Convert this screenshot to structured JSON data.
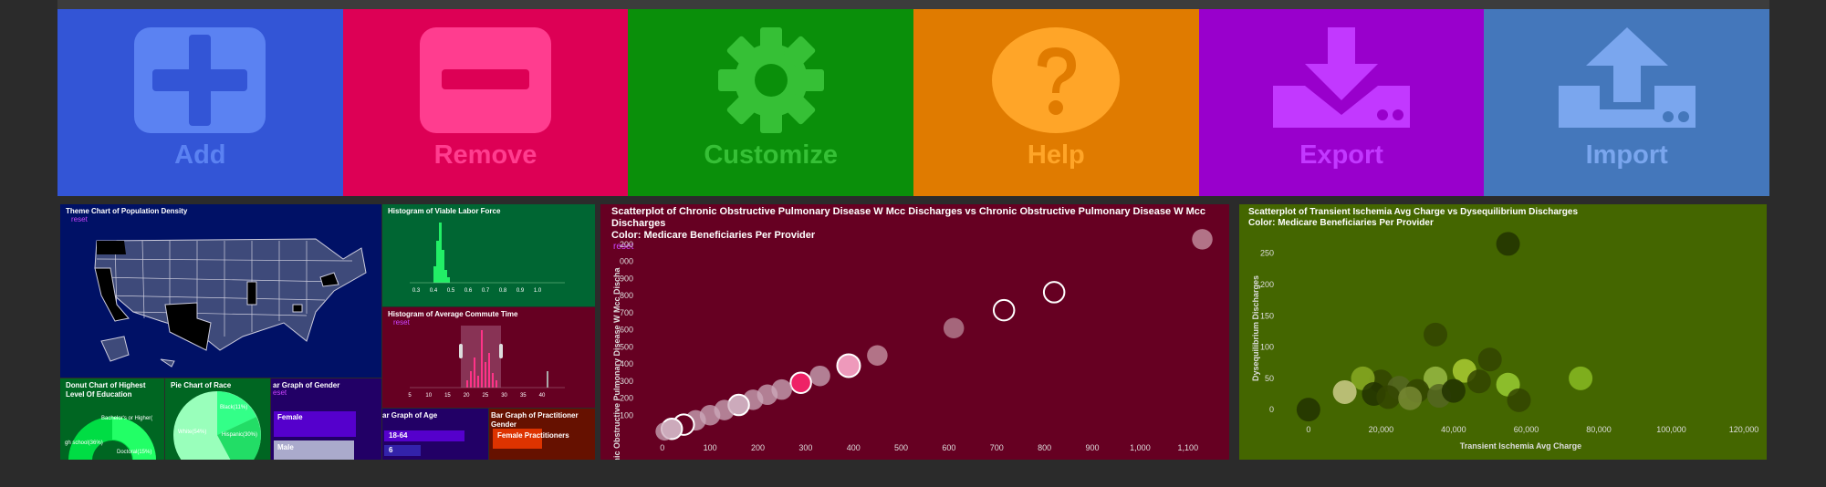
{
  "toolbar": {
    "tiles": [
      {
        "label": "Add",
        "icon": "plus-icon",
        "bg": "#3355d6",
        "fg": "#5b82f2"
      },
      {
        "label": "Remove",
        "icon": "minus-icon",
        "bg": "#dd0055",
        "fg": "#ff3d8f"
      },
      {
        "label": "Customize",
        "icon": "gear-icon",
        "bg": "#0a8f0a",
        "fg": "#36c036"
      },
      {
        "label": "Help",
        "icon": "question-icon",
        "bg": "#e07b00",
        "fg": "#ffa528"
      },
      {
        "label": "Export",
        "icon": "download-icon",
        "bg": "#9900cc",
        "fg": "#c238ff"
      },
      {
        "label": "Import",
        "icon": "upload-icon",
        "bg": "#4477bb",
        "fg": "#7aa6ee"
      }
    ]
  },
  "dashboard": {
    "map": {
      "title": "Theme Chart of Population Density",
      "reset": "reset",
      "bg": "#001166"
    },
    "hist_labor": {
      "title": "Histogram of Viable Labor Force",
      "bg": "#006633",
      "ticks": [
        "0.3",
        "0.4",
        "0.5",
        "0.6",
        "0.7",
        "0.8",
        "0.9",
        "1.0"
      ]
    },
    "hist_commute": {
      "title": "Histogram of Average Commute Time",
      "reset": "reset",
      "bg": "#660022",
      "ticks": [
        "5",
        "10",
        "15",
        "20",
        "25",
        "30",
        "35",
        "40"
      ]
    },
    "donut": {
      "title": "Donut Chart of Highest Level Of Education",
      "labels": [
        "Bachelor's or Higher(",
        "gh school(36%)",
        "Doctoral(15%)"
      ],
      "bg": "#006622"
    },
    "pie": {
      "title": "Pie Chart of Race",
      "labels": [
        "Black(11%)",
        "Hispanic(30%)",
        "White(54%)"
      ],
      "bg": "#006622"
    },
    "gender_bar": {
      "title": "ar Graph of Gender",
      "reset": "eset",
      "labels": [
        "Female",
        "Male"
      ],
      "bg": "#220066"
    },
    "age_bar": {
      "title": "ar Graph of Age",
      "labels": [
        "18-64",
        "6"
      ],
      "bg": "#220066"
    },
    "practitioner_bar": {
      "title": "Bar Graph of Practitioner Gender",
      "labels": [
        "Female Practitioners"
      ],
      "bg": "#661100"
    }
  },
  "scatter1": {
    "title": "Scatterplot of Chronic Obstructive Pulmonary Disease W Mcc Discharges vs Chronic Obstructive Pulmonary Disease W Mcc Discharges",
    "subtitle": "Color: Medicare Beneficiaries Per Provider",
    "reset": "reset",
    "bg": "#660022"
  },
  "scatter2": {
    "title": "Scatterplot of Transient Ischemia Avg Charge vs Dysequilibrium Discharges",
    "subtitle": "Color: Medicare Beneficiaries Per Provider",
    "bg": "#446600"
  },
  "chart_data": [
    {
      "type": "scatter",
      "ylabel": "Chronic Obstructive Pulmonary Disease W Mcc Discha",
      "xlim": [
        -30,
        1150
      ],
      "ylim": [
        0,
        1100
      ],
      "xticks": [
        0,
        100,
        200,
        300,
        400,
        500,
        600,
        700,
        800,
        900,
        1000,
        1100
      ],
      "xtick_labels": [
        "0",
        "100",
        "200",
        "300",
        "400",
        "500",
        "600",
        "700",
        "800",
        "900",
        "1,000",
        "1,100"
      ],
      "yticks": [
        100,
        200,
        300,
        400,
        500,
        600,
        700,
        800,
        900,
        1000,
        1100
      ],
      "ytick_labels": [
        "100",
        "200",
        "300",
        "400",
        "500",
        "600",
        "700",
        "800",
        "900",
        "000",
        "200"
      ],
      "points": [
        {
          "x": 1130,
          "y": 1130,
          "c": "#cc99aa",
          "r": 9,
          "ring": false
        },
        {
          "x": 820,
          "y": 820,
          "c": "#660022",
          "r": 9,
          "ring": true
        },
        {
          "x": 715,
          "y": 715,
          "c": "#660022",
          "r": 9,
          "ring": true
        },
        {
          "x": 610,
          "y": 610,
          "c": "#bb8899",
          "r": 9,
          "ring": false
        },
        {
          "x": 450,
          "y": 450,
          "c": "#cc99aa",
          "r": 9,
          "ring": false
        },
        {
          "x": 390,
          "y": 390,
          "c": "#ee99bb",
          "r": 10,
          "ring": true
        },
        {
          "x": 330,
          "y": 330,
          "c": "#ccaabb",
          "r": 9,
          "ring": false
        },
        {
          "x": 290,
          "y": 290,
          "c": "#ee2266",
          "r": 9,
          "ring": true
        },
        {
          "x": 250,
          "y": 250,
          "c": "#ccaabb",
          "r": 9,
          "ring": false
        },
        {
          "x": 220,
          "y": 220,
          "c": "#ccaabb",
          "r": 9,
          "ring": false
        },
        {
          "x": 190,
          "y": 190,
          "c": "#ccaabb",
          "r": 9,
          "ring": false
        },
        {
          "x": 160,
          "y": 160,
          "c": "#ccaabb",
          "r": 9,
          "ring": true
        },
        {
          "x": 130,
          "y": 130,
          "c": "#ccaabb",
          "r": 9,
          "ring": false
        },
        {
          "x": 100,
          "y": 100,
          "c": "#ccaabb",
          "r": 9,
          "ring": false
        },
        {
          "x": 70,
          "y": 70,
          "c": "#ccaabb",
          "r": 9,
          "ring": false
        },
        {
          "x": 45,
          "y": 45,
          "c": "#660022",
          "r": 9,
          "ring": true
        },
        {
          "x": 20,
          "y": 20,
          "c": "#ccaabb",
          "r": 9,
          "ring": true
        },
        {
          "x": 5,
          "y": 5,
          "c": "#ccaabb",
          "r": 8,
          "ring": false
        }
      ]
    },
    {
      "type": "scatter",
      "xlabel": "Transient Ischemia Avg Charge",
      "ylabel": "Dysequilibrium Discharges",
      "xlim": [
        -6000,
        123000
      ],
      "ylim": [
        -10,
        270
      ],
      "xticks": [
        0,
        20000,
        40000,
        60000,
        80000,
        100000,
        120000
      ],
      "xtick_labels": [
        "0",
        "20,000",
        "40,000",
        "60,000",
        "80,000",
        "100,000",
        "120,000"
      ],
      "yticks": [
        0,
        50,
        100,
        150,
        200,
        250
      ],
      "ytick_labels": [
        "0",
        "50",
        "100",
        "150",
        "200",
        "250"
      ],
      "points": [
        {
          "x": 55000,
          "y": 265,
          "c": "#223300"
        },
        {
          "x": 35000,
          "y": 120,
          "c": "#334400"
        },
        {
          "x": 50000,
          "y": 80,
          "c": "#334400"
        },
        {
          "x": 43000,
          "y": 62,
          "c": "#aacc33"
        },
        {
          "x": 75000,
          "y": 50,
          "c": "#88bb22"
        },
        {
          "x": 55000,
          "y": 40,
          "c": "#99cc33"
        },
        {
          "x": 47000,
          "y": 45,
          "c": "#334400"
        },
        {
          "x": 35000,
          "y": 50,
          "c": "#99bb44"
        },
        {
          "x": 20000,
          "y": 45,
          "c": "#334400"
        },
        {
          "x": 15000,
          "y": 50,
          "c": "#88aa22"
        },
        {
          "x": 25000,
          "y": 35,
          "c": "#556622"
        },
        {
          "x": 30000,
          "y": 30,
          "c": "#334400"
        },
        {
          "x": 18000,
          "y": 25,
          "c": "#223300"
        },
        {
          "x": 10000,
          "y": 28,
          "c": "#cccc88"
        },
        {
          "x": 22000,
          "y": 20,
          "c": "#334400"
        },
        {
          "x": 28000,
          "y": 18,
          "c": "#778833"
        },
        {
          "x": 36000,
          "y": 22,
          "c": "#556622"
        },
        {
          "x": 40000,
          "y": 30,
          "c": "#223300"
        },
        {
          "x": 58000,
          "y": 15,
          "c": "#334400"
        },
        {
          "x": 0,
          "y": 0,
          "c": "#223300"
        }
      ]
    }
  ]
}
